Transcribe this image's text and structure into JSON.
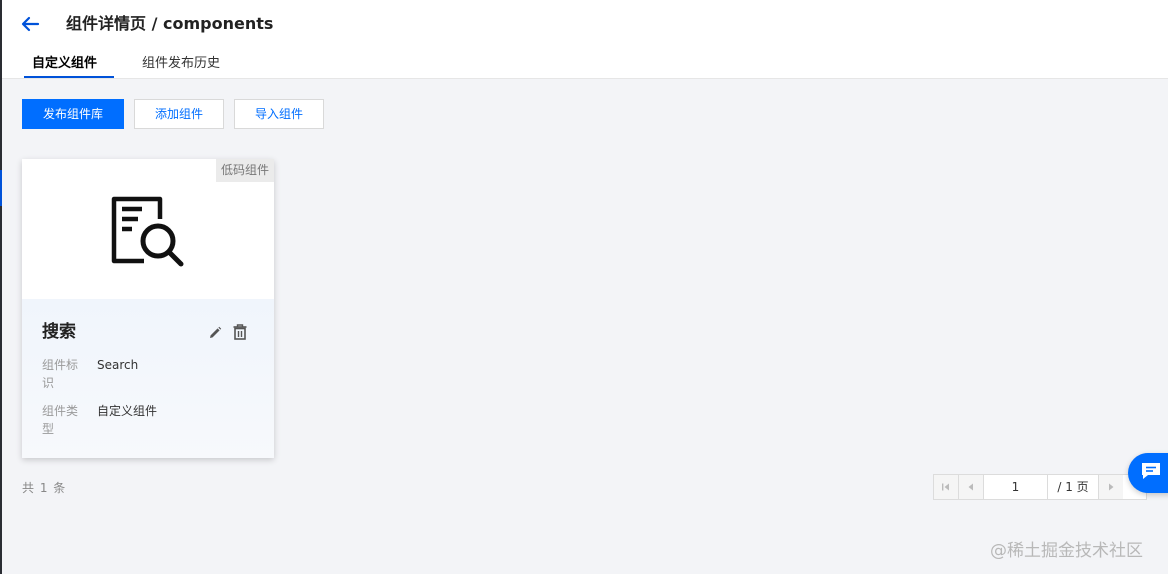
{
  "header": {
    "title": "组件详情页 / components",
    "tabs": [
      {
        "label": "自定义组件",
        "active": true
      },
      {
        "label": "组件发布历史",
        "active": false
      }
    ]
  },
  "toolbar": {
    "publish_label": "发布组件库",
    "add_label": "添加组件",
    "import_label": "导入组件"
  },
  "card": {
    "badge": "低码组件",
    "icon": "document-search-icon",
    "title": "搜索",
    "fields": [
      {
        "label": "组件标识",
        "value": "Search"
      },
      {
        "label": "组件类型",
        "value": "自定义组件"
      }
    ]
  },
  "footer": {
    "total": "共 1 条"
  },
  "pagination": {
    "current_page": "1",
    "total_pages": "/ 1 页"
  },
  "watermark": "@稀土掘金技术社区",
  "colors": {
    "primary": "#006eff",
    "tab_underline": "#0052d9",
    "background": "#f3f4f7"
  }
}
